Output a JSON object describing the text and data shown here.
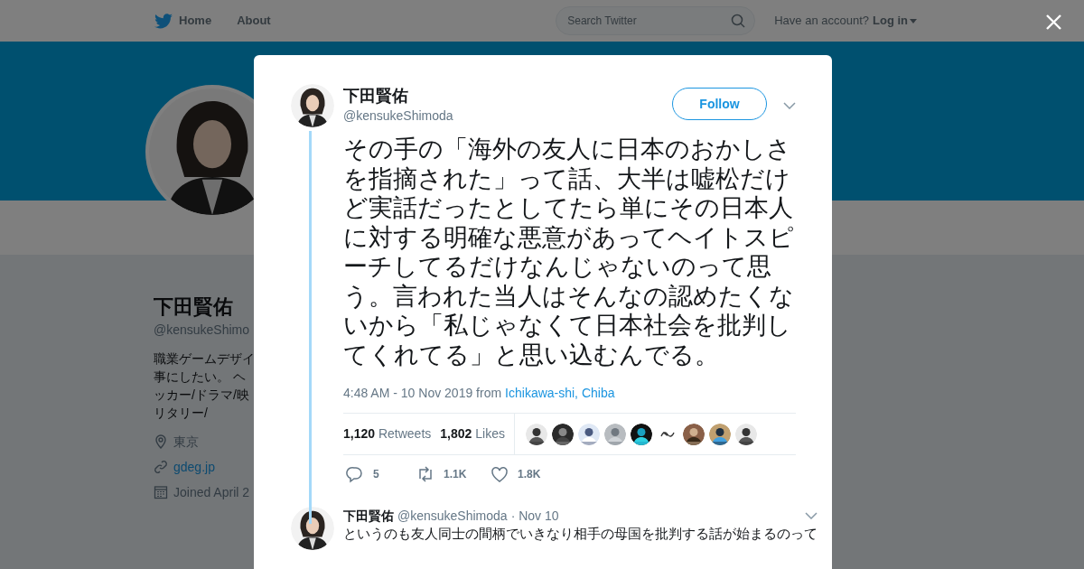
{
  "nav": {
    "links": [
      {
        "label": "Home"
      },
      {
        "label": "About"
      }
    ],
    "search_placeholder": "Search Twitter",
    "account_prompt": "Have an account?",
    "login": "Log in"
  },
  "profile": {
    "name": "下田賢佑",
    "handle": "@kensukeShimo",
    "bio_lines": [
      "職業ゲームデザイ",
      "事にしたい。 ヘ",
      "ッカー/ドラマ/映",
      "リタリー/"
    ],
    "location": "東京",
    "website": "gdeg.jp",
    "joined": "Joined April 2"
  },
  "tweet": {
    "name": "下田賢佑",
    "handle": "@kensukeShimoda",
    "follow": "Follow",
    "text": "その手の「海外の友人に日本のおかしさを指摘された」って話、大半は嘘松だけど実話だったとしてたら単にその日本人に対する明確な悪意があってヘイトスピーチしてるだけなんじゃないのって思う。言われた当人はそんなの認めたくないから「私じゃなくて日本社会を批判してくれてる」と思い込むんでる。",
    "timestamp": "4:48 AM - 10 Nov 2019 from",
    "place": "Ichikawa-shi, Chiba",
    "stats": [
      {
        "count": "1,120",
        "label": "Retweets"
      },
      {
        "count": "1,802",
        "label": "Likes"
      }
    ],
    "liker_avatars": [
      {
        "kind": "picture"
      },
      {
        "kind": "picture"
      },
      {
        "kind": "picture"
      },
      {
        "kind": "picture"
      },
      {
        "kind": "picture"
      },
      {
        "kind": "squiggle"
      },
      {
        "kind": "picture"
      },
      {
        "kind": "picture"
      },
      {
        "kind": "picture"
      }
    ],
    "actions": [
      {
        "kind": "reply",
        "count": "5"
      },
      {
        "kind": "retweet",
        "count": "1.1K"
      },
      {
        "kind": "like",
        "count": "1.8K"
      }
    ]
  },
  "reply": {
    "name": "下田賢佑",
    "handle": "@kensukeShimoda",
    "date": "· Nov 10",
    "text": "というのも友人同士の間柄でいきなり相手の母国を批判する話が始まるのって"
  }
}
